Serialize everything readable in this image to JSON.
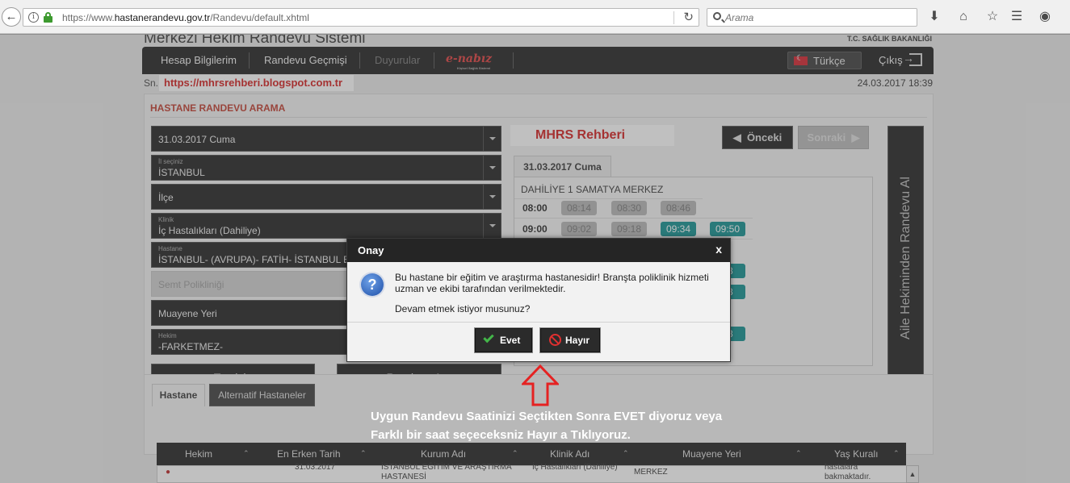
{
  "browser": {
    "url_prefix": "https://www.",
    "url_domain": "hastanerandevu.gov.tr",
    "url_path": "/Randevu/default.xhtml",
    "search_placeholder": "Arama"
  },
  "header": {
    "site_title": "Merkezi Hekim Randevu Sistemi",
    "ministry": "T.C. SAĞLIK BAKANLIĞI",
    "nav": {
      "account": "Hesap Bilgilerim",
      "history": "Randevu Geçmişi",
      "announcements": "Duyurular",
      "enabiz": "e-nabız",
      "enabiz_tag": "Kişisel Sağlık Sistemi",
      "language": "Türkçe",
      "logout": "Çıkış"
    }
  },
  "subheader": {
    "sn": "Sn.",
    "promo_url": "https://mhrsrehberi.blogspot.com.tr",
    "datetime": "24.03.2017 18:39"
  },
  "search_panel": {
    "title": "HASTANE RANDEVU ARAMA",
    "date_value": "31.03.2017 Cuma",
    "city_label": "İl seçiniz",
    "city_value": "İSTANBUL",
    "district_value": "İlçe",
    "clinic_label": "Klinik",
    "clinic_value": "İç Hastalıkları (Dahiliye)",
    "hospital_label": "Hastane",
    "hospital_value": "İSTANBUL- (AVRUPA)- FATİH- İSTANBUL EĞİTİM VE ARAŞTIRMA HASTANESİ",
    "polyclinic_placeholder": "Semt Polikliniği",
    "location_value": "Muayene Yeri",
    "doctor_label": "Hekim",
    "doctor_value": "-FARKETMEZ-",
    "clear_button": "Temizle",
    "search_button": "Randevu Ara"
  },
  "schedule": {
    "banner": "MHRS Rehberi",
    "prev_button": "Önceki",
    "next_button": "Sonraki",
    "side_button": "Aile Hekiminden Randevu Al",
    "date_tab": "31.03.2017 Cuma",
    "clinic": "DAHİLİYE 1 SAMATYA MERKEZ",
    "rows": [
      {
        "hour": "08:00",
        "slots": [
          {
            "time": "08:14",
            "status": "taken"
          },
          {
            "time": "08:30",
            "status": "taken"
          },
          {
            "time": "08:46",
            "status": "taken"
          }
        ]
      },
      {
        "hour": "09:00",
        "slots": [
          {
            "time": "09:02",
            "status": "taken"
          },
          {
            "time": "09:18",
            "status": "taken"
          },
          {
            "time": "09:34",
            "status": "open"
          },
          {
            "time": "09:50",
            "status": "open"
          }
        ]
      }
    ],
    "partial_slots": [
      "48",
      "48",
      "48"
    ]
  },
  "results": {
    "tab_hospital": "Hastane",
    "tab_alternative": "Alternatif Hastaneler",
    "columns": [
      "Hekim",
      "En Erken Tarih",
      "Kurum Adı",
      "Klinik Adı",
      "Muayene Yeri",
      "Yaş Kuralı"
    ],
    "row": {
      "date": "31.03.2017",
      "institution_1": "İSTANBUL EĞİTİM VE ARAŞTIRMA",
      "institution_2": "HASTANESİ",
      "clinic": "İç Hastalıkları (Dahiliye)",
      "location": "MERKEZ",
      "age_1": "hastalara",
      "age_2": "bakmaktadır."
    }
  },
  "modal": {
    "title": "Onay",
    "close": "x",
    "message": "Bu hastane bir eğitim ve araştırma hastanesidir! Branşta poliklinik hizmeti uzman ve ekibi tarafından verilmektedir.",
    "question": "Devam etmek istiyor musunuz?",
    "yes": "Evet",
    "no": "Hayır"
  },
  "annotation": {
    "line1": "Uygun Randevu Saatinizi Seçtikten Sonra EVET diyoruz veya",
    "line2": "Farklı bir saat seçeceksniz Hayır a Tıklıyoruz."
  },
  "colors": {
    "accent_red": "#c0392b",
    "slot_open": "#0e8f8f",
    "slot_taken": "#b5b5b5",
    "nav_dark": "#1e1e1e"
  }
}
